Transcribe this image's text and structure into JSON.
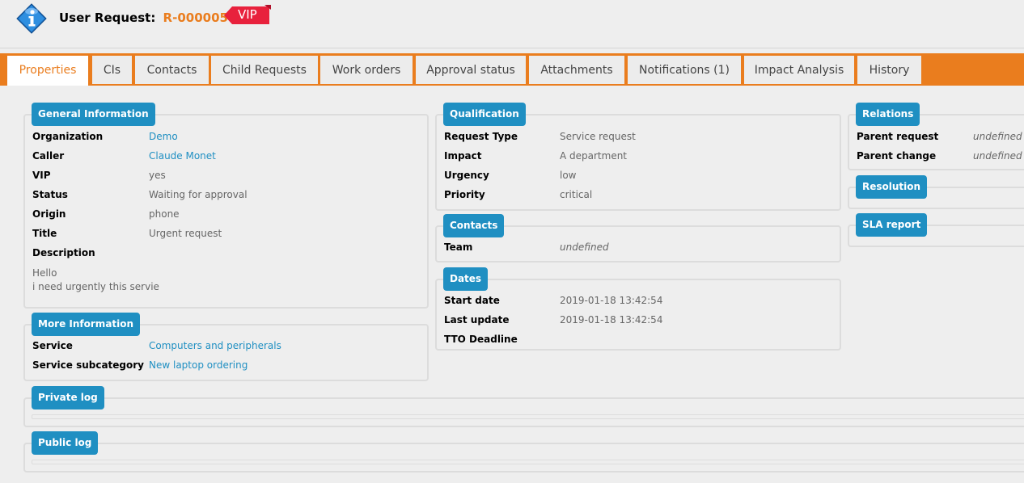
{
  "header": {
    "title_prefix": "User Request:",
    "ref": "R-000005",
    "vip_badge": "VIP",
    "icon": "info-icon"
  },
  "colors": {
    "accent": "#ea7d1e",
    "legend": "#1f8fc2",
    "vip": "#e8213c"
  },
  "tabs": [
    {
      "label": "Properties",
      "active": true
    },
    {
      "label": "CIs"
    },
    {
      "label": "Contacts"
    },
    {
      "label": "Child Requests"
    },
    {
      "label": "Work orders"
    },
    {
      "label": "Approval status"
    },
    {
      "label": "Attachments"
    },
    {
      "label": "Notifications (1)"
    },
    {
      "label": "Impact Analysis"
    },
    {
      "label": "History"
    }
  ],
  "general": {
    "legend": "General Information",
    "fields": [
      {
        "label": "Organization",
        "value": "Demo"
      },
      {
        "label": "Caller",
        "value": "Claude Monet"
      },
      {
        "label": "VIP",
        "value": "yes"
      },
      {
        "label": "Status",
        "value": "Waiting for approval"
      },
      {
        "label": "Origin",
        "value": "phone"
      },
      {
        "label": "Title",
        "value": "Urgent request"
      },
      {
        "label": "Description",
        "value": ""
      }
    ],
    "description_lines": [
      "Hello",
      "i need urgently this servie"
    ]
  },
  "more": {
    "legend": "More Information",
    "fields": [
      {
        "label": "Service",
        "value": "Computers and peripherals"
      },
      {
        "label": "Service subcategory",
        "value": "New laptop ordering"
      }
    ]
  },
  "qualification": {
    "legend": "Qualification",
    "fields": [
      {
        "label": "Request Type",
        "value": "Service request"
      },
      {
        "label": "Impact",
        "value": "A department"
      },
      {
        "label": "Urgency",
        "value": "low"
      },
      {
        "label": "Priority",
        "value": "critical"
      }
    ]
  },
  "contacts": {
    "legend": "Contacts",
    "fields": [
      {
        "label": "Team",
        "value": "undefined"
      }
    ]
  },
  "dates": {
    "legend": "Dates",
    "fields": [
      {
        "label": "Start date",
        "value": "2019-01-18 13:42:54"
      },
      {
        "label": "Last update",
        "value": "2019-01-18 13:42:54"
      },
      {
        "label": "TTO Deadline",
        "value": ""
      }
    ]
  },
  "relations": {
    "legend": "Relations",
    "fields": [
      {
        "label": "Parent request",
        "value": "undefined"
      },
      {
        "label": "Parent change",
        "value": "undefined"
      }
    ]
  },
  "resolution": {
    "legend": "Resolution"
  },
  "sla": {
    "legend": "SLA report"
  },
  "private_log": {
    "legend": "Private log"
  },
  "public_log": {
    "legend": "Public log"
  }
}
